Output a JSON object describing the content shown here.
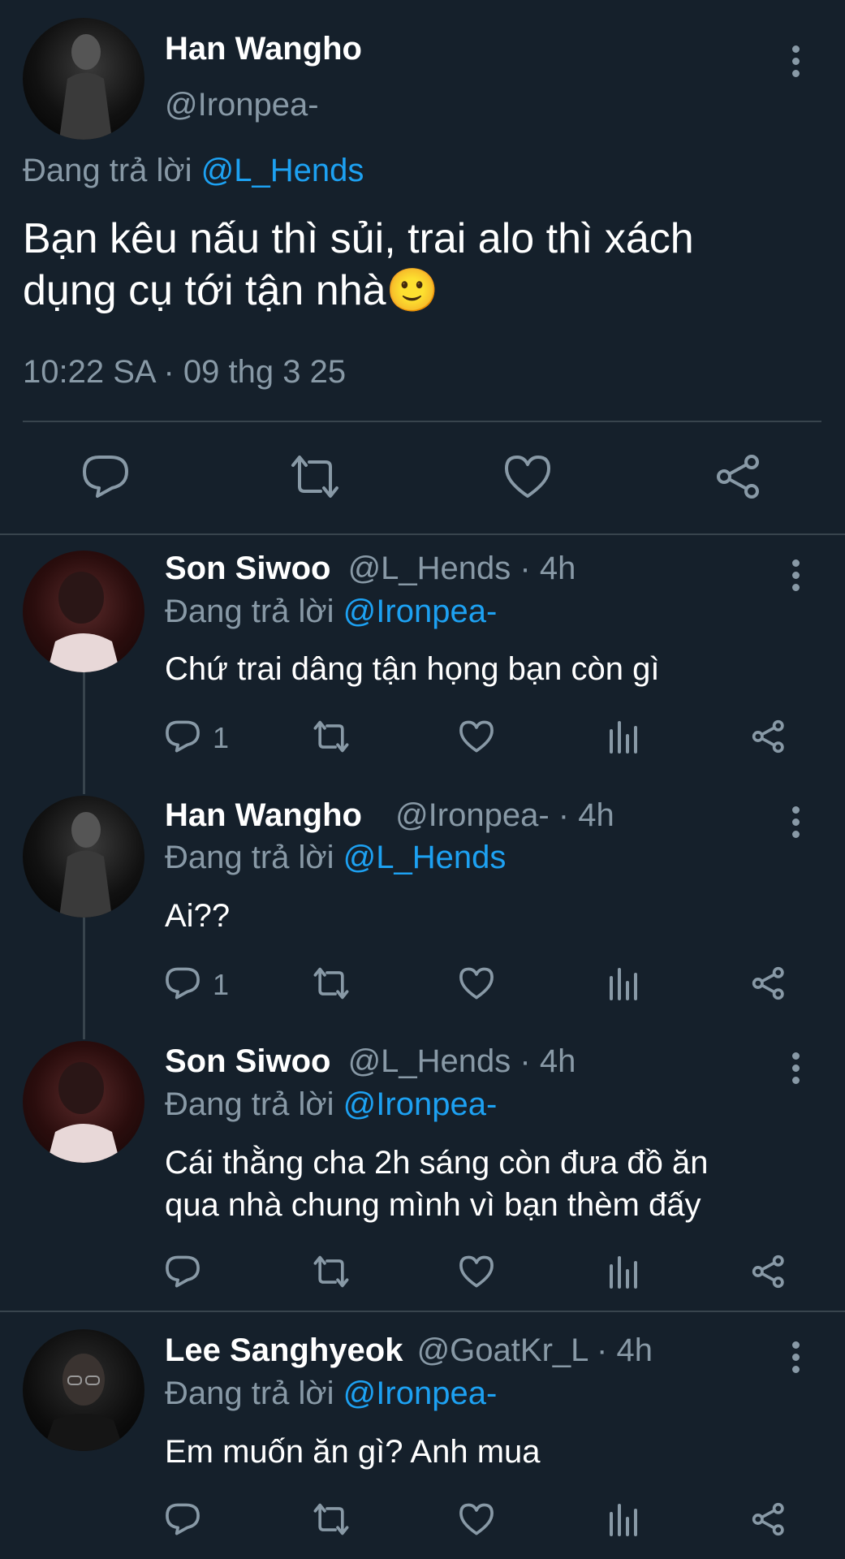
{
  "main_tweet": {
    "display_name": "Han Wangho",
    "handle": "@Ironpea-",
    "replying_prefix": "Đang trả lời",
    "replying_to": "@L_Hends",
    "text_line1": "Bạn kêu nấu thì sủi, trai alo thì xách",
    "text_line2": "dụng cụ tới tận nhà",
    "emoji": "🙂",
    "timestamp": "10:22 SA · 09 thg 3 25"
  },
  "replies": [
    {
      "display_name": "Son Siwoo",
      "handle": "@L_Hends · 4h",
      "replying_prefix": "Đang trả lời",
      "replying_to": "@Ironpea-",
      "text_line1": "Chứ trai dâng tận họng bạn còn gì",
      "text_line2": "",
      "reply_count": "1"
    },
    {
      "display_name": "Han Wangho",
      "handle": "@Ironpea- · 4h",
      "replying_prefix": "Đang trả lời",
      "replying_to": "@L_Hends",
      "text_line1": "Ai??",
      "text_line2": "",
      "reply_count": "1"
    },
    {
      "display_name": "Son Siwoo",
      "handle": "@L_Hends · 4h",
      "replying_prefix": "Đang trả lời",
      "replying_to": "@Ironpea-",
      "text_line1": "Cái thằng cha 2h sáng còn đưa đồ ăn",
      "text_line2": "qua nhà chung mình vì bạn thèm đấy",
      "reply_count": ""
    },
    {
      "display_name": "Lee Sanghyeok",
      "handle": "@GoatKr_L · 4h",
      "replying_prefix": "Đang trả lời",
      "replying_to": "@Ironpea-",
      "text_line1": "Em muốn ăn gì? Anh mua",
      "text_line2": "",
      "reply_count": ""
    }
  ],
  "icons": {
    "reply": "reply-icon",
    "retweet": "retweet-icon",
    "like": "like-icon",
    "share": "share-icon",
    "analytics": "analytics-icon",
    "more": "more-options-icon"
  },
  "colors": {
    "background": "#15202b",
    "accent": "#1da1f2",
    "muted": "#8899a6",
    "divider": "#38444d"
  }
}
